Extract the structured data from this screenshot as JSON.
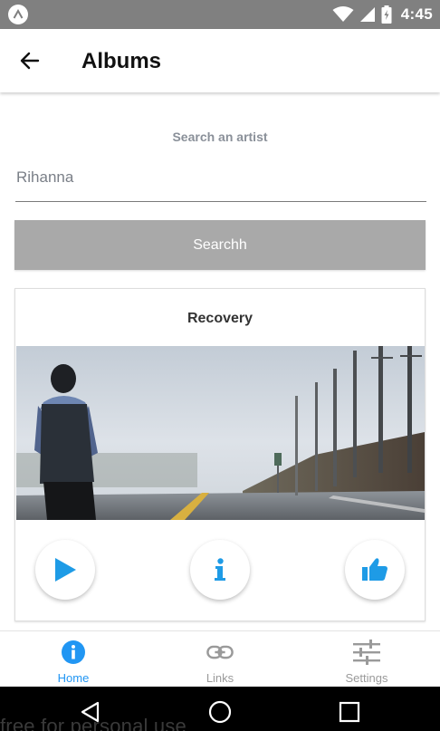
{
  "status_bar": {
    "time": "4:45",
    "icons": [
      "app-logo-icon",
      "wifi-icon",
      "cell-signal-icon",
      "battery-icon"
    ]
  },
  "app_bar": {
    "title": "Albums",
    "back_icon": "arrow-back-icon"
  },
  "search": {
    "label": "Search an artist",
    "value": "Rihanna",
    "button_label": "Searchh"
  },
  "album_card": {
    "title": "Recovery",
    "image": "person-on-road-photo",
    "actions": [
      {
        "icon": "play-icon"
      },
      {
        "icon": "info-icon"
      },
      {
        "icon": "thumbs-up-icon"
      }
    ]
  },
  "bottom_nav": {
    "items": [
      {
        "label": "Home",
        "icon": "info-circle-icon",
        "active": true
      },
      {
        "label": "Links",
        "icon": "link-icon",
        "active": false
      },
      {
        "label": "Settings",
        "icon": "sliders-icon",
        "active": false
      }
    ]
  },
  "system_nav": {
    "icons": [
      "back-triangle-icon",
      "home-circle-icon",
      "recents-square-icon"
    ]
  },
  "watermark": "free for personal use",
  "colors": {
    "status_bar": "#808080",
    "accent": "#2196f3",
    "button": "#a9a9a9",
    "inactive": "#9a9a9a"
  }
}
